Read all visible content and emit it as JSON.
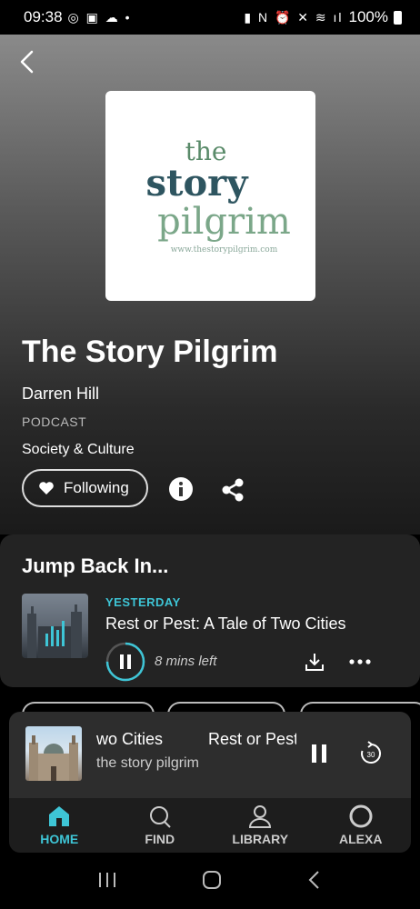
{
  "status": {
    "time": "09:38",
    "battery": "100%"
  },
  "podcast": {
    "cover": {
      "line1": "the",
      "line2": "story",
      "line3": "pilgrim",
      "url": "www.thestorypilgrim.com"
    },
    "title": "The Story Pilgrim",
    "author": "Darren Hill",
    "type": "PODCAST",
    "category": "Society & Culture",
    "follow_label": "Following"
  },
  "jump_back": {
    "heading": "Jump Back In...",
    "episode": {
      "when": "YESTERDAY",
      "title": "Rest or Pest: A Tale of Two Cities",
      "remaining": "8 mins left",
      "progress": 0.75
    }
  },
  "mini_player": {
    "title": "wo Cities          Rest or Pest",
    "subtitle": "the story pilgrim",
    "skip_label": "30"
  },
  "nav": [
    {
      "label": "HOME",
      "icon": "home-icon",
      "active": true
    },
    {
      "label": "FIND",
      "icon": "search-icon",
      "active": false
    },
    {
      "label": "LIBRARY",
      "icon": "person-icon",
      "active": false
    },
    {
      "label": "ALEXA",
      "icon": "alexa-icon",
      "active": false
    }
  ],
  "colors": {
    "accent": "#3ec5d6",
    "cover_green": "#7ba789",
    "cover_dark": "#2e5560"
  }
}
